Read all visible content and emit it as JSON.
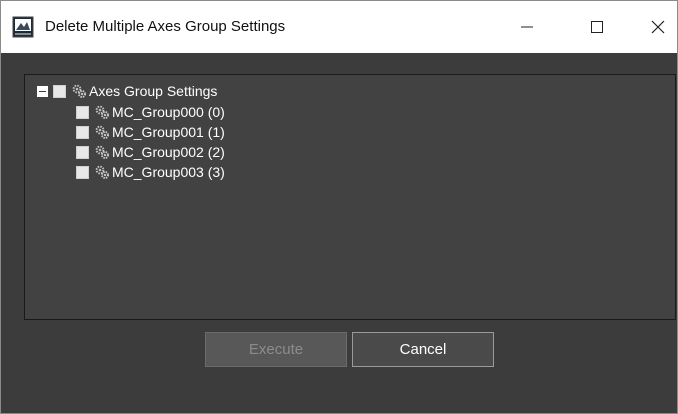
{
  "window": {
    "title": "Delete Multiple Axes Group Settings",
    "icon": "app-monitor-icon",
    "controls": {
      "minimize": "–",
      "maximize": "☐",
      "close": "✕"
    }
  },
  "tree": {
    "root": {
      "label": "Axes Group Settings",
      "expanded": true,
      "checked": false,
      "icon": "gear-icon"
    },
    "items": [
      {
        "label": "MC_Group000 (0)",
        "checked": false,
        "icon": "gear-icon"
      },
      {
        "label": "MC_Group001 (1)",
        "checked": false,
        "icon": "gear-icon"
      },
      {
        "label": "MC_Group002 (2)",
        "checked": false,
        "icon": "gear-icon"
      },
      {
        "label": "MC_Group003 (3)",
        "checked": false,
        "icon": "gear-icon"
      }
    ]
  },
  "buttons": {
    "execute": "Execute",
    "cancel": "Cancel"
  },
  "colors": {
    "window_bg": "#3c3c3c",
    "panel_bg": "#424242",
    "text": "#ffffff",
    "disabled_text": "#8c8c8c"
  }
}
